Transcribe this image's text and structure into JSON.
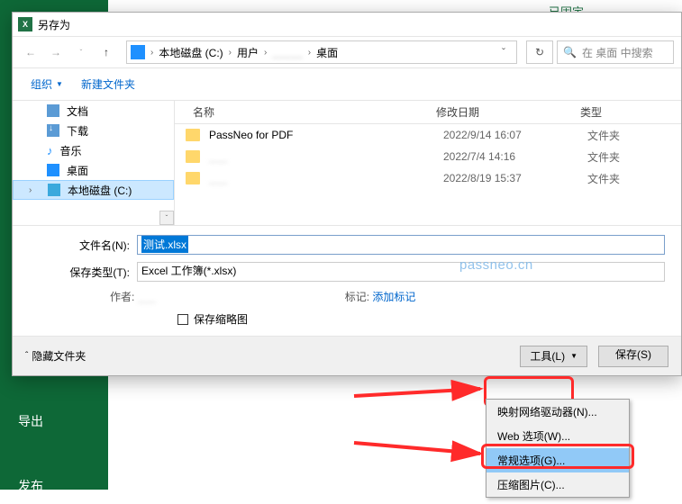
{
  "excel_bg": {
    "top_fixed": "已固定",
    "export": "导出",
    "publish": "发布"
  },
  "dialog": {
    "title": "另存为",
    "breadcrumb": {
      "drive": "本地磁盘 (C:)",
      "users": "用户",
      "hidden": "_____",
      "desktop": "桌面"
    },
    "search_placeholder": "在 桌面 中搜索",
    "organize": "组织",
    "new_folder": "新建文件夹",
    "sidebar": [
      {
        "label": "文档"
      },
      {
        "label": "下载"
      },
      {
        "label": "音乐"
      },
      {
        "label": "桌面"
      },
      {
        "label": "本地磁盘 (C:)"
      }
    ],
    "columns": {
      "name": "名称",
      "date": "修改日期",
      "type": "类型"
    },
    "rows": [
      {
        "name": "PassNeo for PDF",
        "date": "2022/9/14 16:07",
        "type": "文件夹",
        "blur": false
      },
      {
        "name": "___",
        "date": "2022/7/4 14:16",
        "type": "文件夹",
        "blur": true
      },
      {
        "name": "___",
        "date": "2022/8/19 15:37",
        "type": "文件夹",
        "blur": true
      }
    ],
    "filename_label": "文件名(N):",
    "filename_value": "测试.xlsx",
    "filetype_label": "保存类型(T):",
    "filetype_value": "Excel 工作簿(*.xlsx)",
    "author_label": "作者:",
    "author_value": "___",
    "tags_label": "标记:",
    "tags_value": "添加标记",
    "thumb_label": "保存缩略图",
    "hide_folders": "隐藏文件夹",
    "tools_btn": "工具(L)",
    "save_btn": "保存(S)"
  },
  "tools_menu": [
    "映射网络驱动器(N)...",
    "Web 选项(W)...",
    "常规选项(G)...",
    "压缩图片(C)..."
  ],
  "watermark": "passneo.cn"
}
